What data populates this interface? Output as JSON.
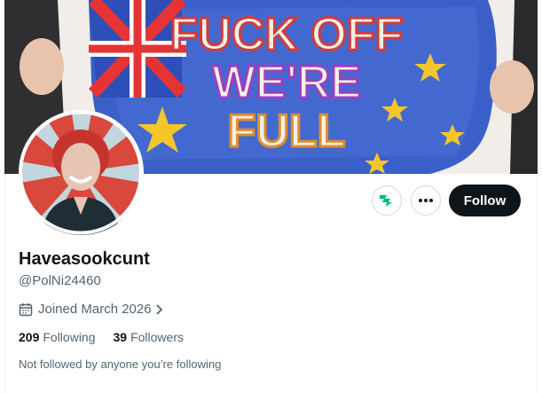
{
  "banner": {
    "sign_lines": [
      "FUCK OFF",
      "WE'RE",
      "FULL"
    ]
  },
  "actions": {
    "subscribe_icon": "superfollow-icon",
    "more_icon": "more-dots-icon",
    "follow_label": "Follow"
  },
  "profile": {
    "display_name": "Haveasookcunt",
    "handle": "@PolNi24460",
    "joined_icon": "calendar-icon",
    "joined": "Joined March 2026",
    "following_count": "209",
    "following_label": "Following",
    "followers_count": "39",
    "followers_label": "Followers",
    "followed_by_note": "Not followed by anyone you’re following"
  },
  "colors": {
    "follow_button": "#0f1419",
    "secondary_text": "#536471",
    "subscribe_icon": "#00ba7c"
  }
}
